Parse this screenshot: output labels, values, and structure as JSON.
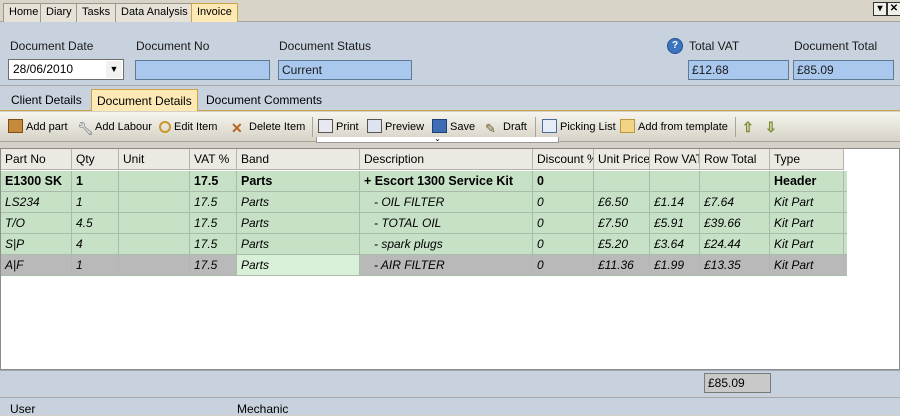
{
  "tabs": [
    "Home",
    "Diary",
    "Tasks",
    "Data Analysis",
    "Invoice"
  ],
  "active_tab": "Invoice",
  "header": {
    "document_date_label": "Document Date",
    "document_date_value": "28/06/2010",
    "document_no_label": "Document No",
    "document_no_value": "",
    "document_status_label": "Document Status",
    "document_status_value": "Current",
    "total_vat_label": "Total VAT",
    "total_vat_value": "£12.68",
    "document_total_label": "Document Total",
    "document_total_value": "£85.09"
  },
  "subtabs": [
    "Client Details",
    "Document Details",
    "Document Comments"
  ],
  "active_subtab": "Document Details",
  "toolbar": {
    "add_part": "Add part",
    "add_labour": "Add Labour",
    "edit_item": "Edit Item",
    "delete_item": "Delete Item",
    "print": "Print",
    "preview": "Preview",
    "save": "Save",
    "draft": "Draft",
    "picking_list": "Picking List",
    "add_from_template": "Add from template"
  },
  "grid": {
    "columns": [
      "Part No",
      "Qty",
      "Unit",
      "VAT %",
      "Band",
      "Description",
      "Discount %",
      "Unit Price",
      "Row VAT",
      "Row Total",
      "Type"
    ],
    "rows": [
      [
        "E1300 SK",
        "1",
        "",
        "17.5",
        "Parts",
        "+ Escort 1300 Service Kit",
        "0",
        "",
        "",
        "",
        "Header"
      ],
      [
        "LS234",
        "1",
        "",
        "17.5",
        "Parts",
        "- OIL FILTER",
        "0",
        "£6.50",
        "£1.14",
        "£7.64",
        "Kit Part"
      ],
      [
        "T/O",
        "4.5",
        "",
        "17.5",
        "Parts",
        "- TOTAL OIL",
        "0",
        "£7.50",
        "£5.91",
        "£39.66",
        "Kit Part"
      ],
      [
        "S|P",
        "4",
        "",
        "17.5",
        "Parts",
        "- spark plugs",
        "0",
        "£5.20",
        "£3.64",
        "£24.44",
        "Kit Part"
      ],
      [
        "A|F",
        "1",
        "",
        "17.5",
        "Parts",
        "- AIR FILTER",
        "0",
        "£11.36",
        "£1.99",
        "£13.35",
        "Kit Part"
      ]
    ]
  },
  "grid_total": "£85.09",
  "footer": {
    "user_label": "User",
    "mechanic_label": "Mechanic"
  },
  "colors": {
    "row_green": "#c6e1c6",
    "selected_row": "#b9b9b9",
    "field_blue": "#aac8ee",
    "active_tab": "#fde9b4"
  }
}
